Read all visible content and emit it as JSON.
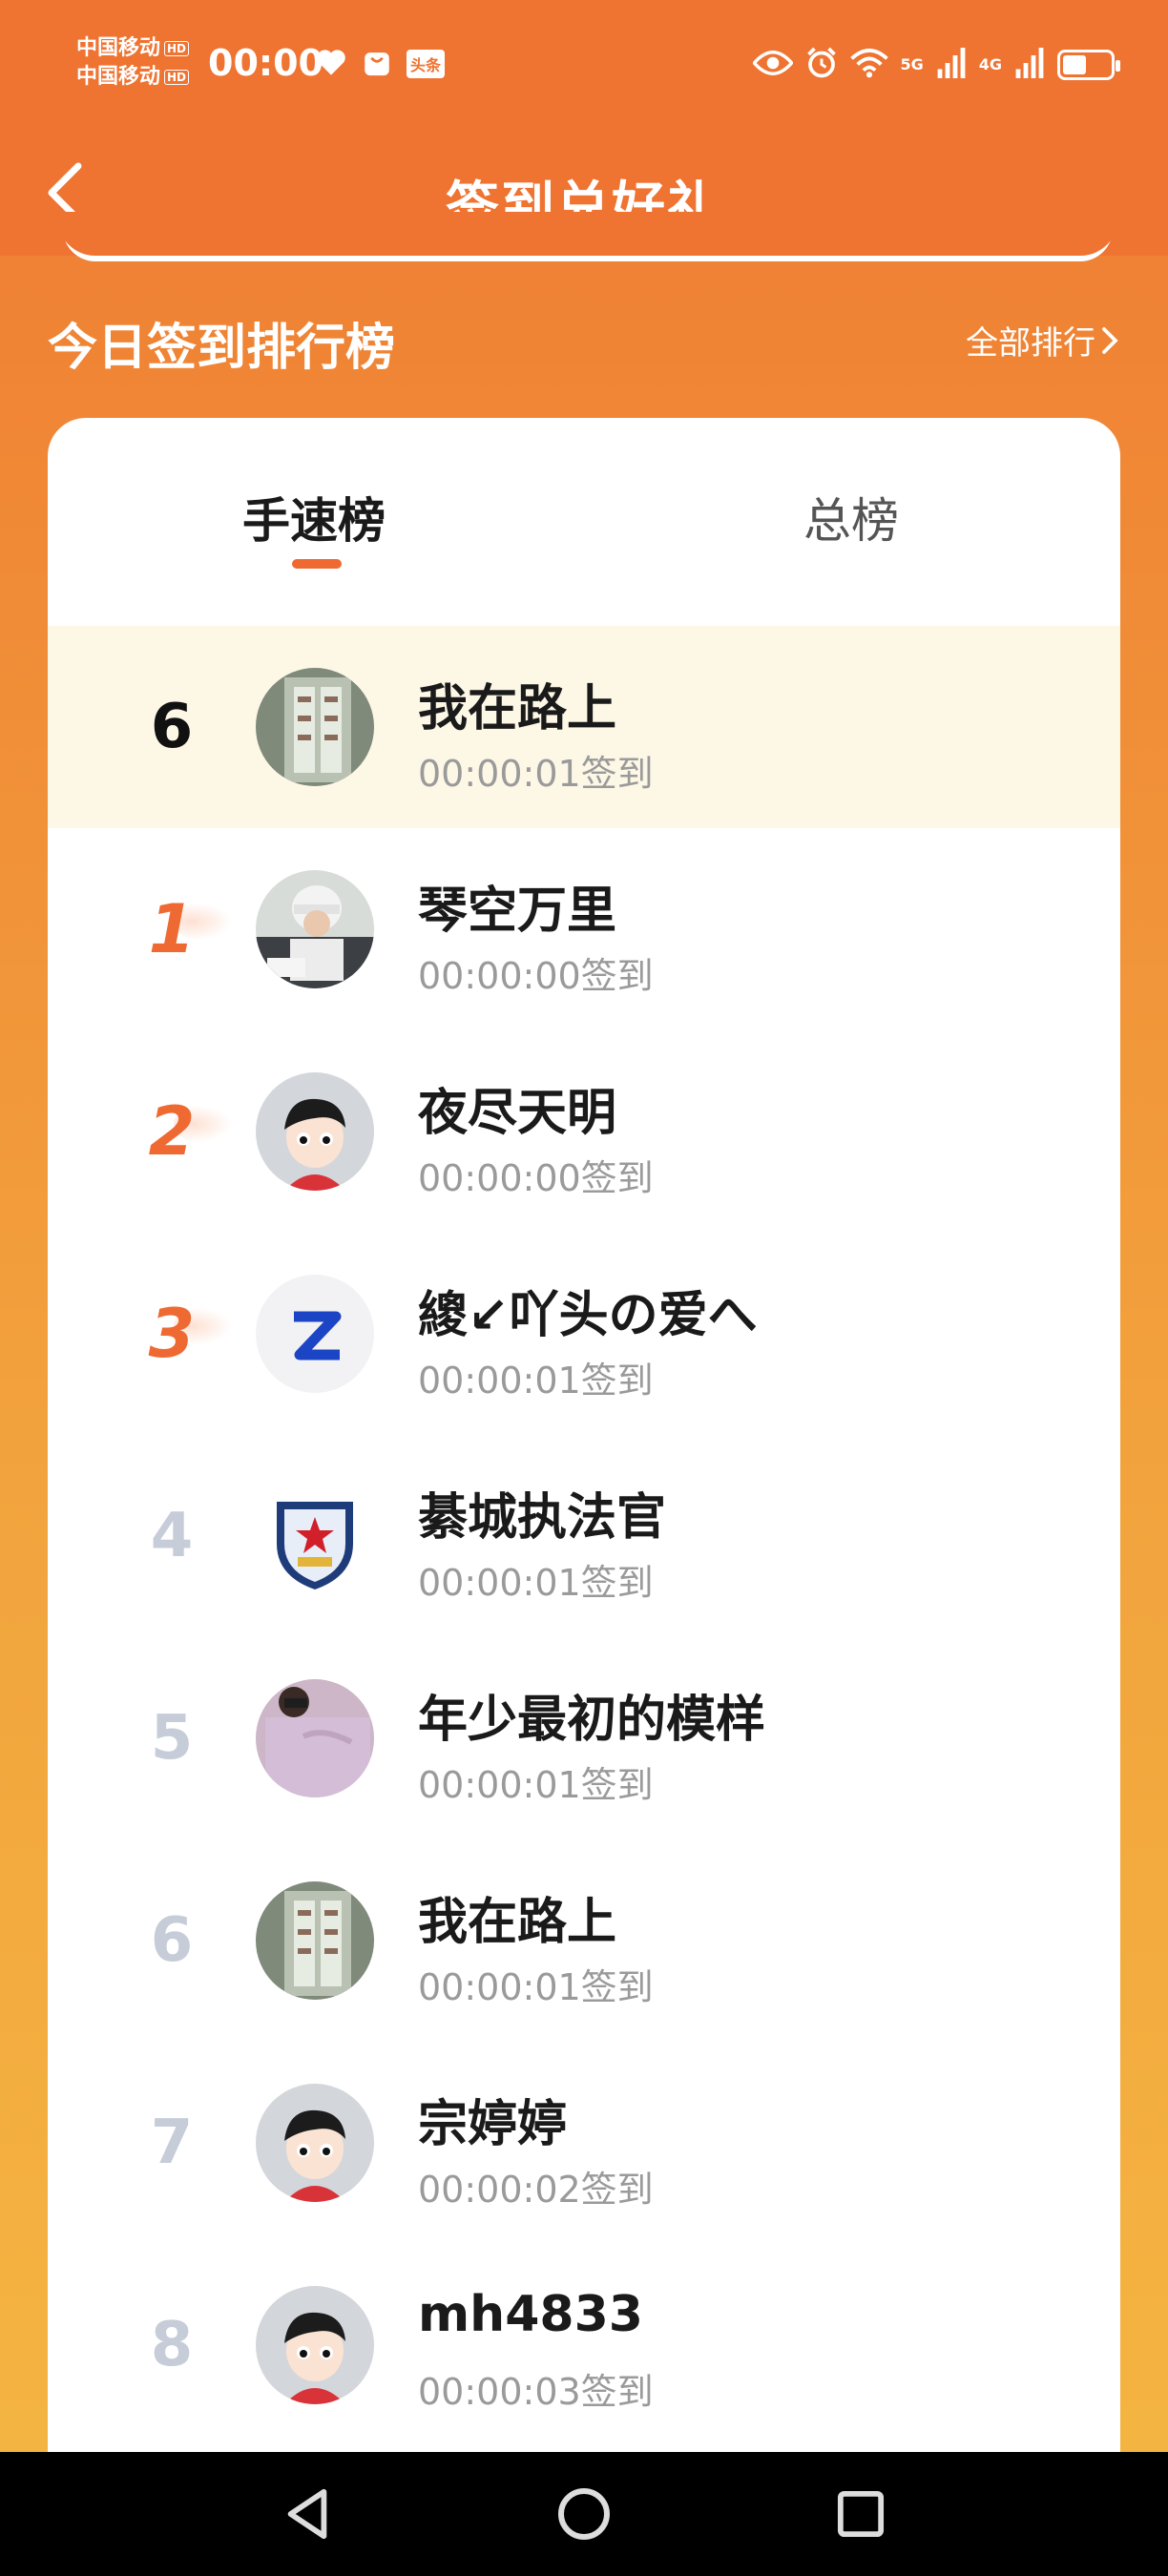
{
  "status_bar": {
    "carrier1": "中国移动",
    "carrier2": "中国移动",
    "hd": "HD",
    "time": "00:00",
    "app_badge": "头条",
    "net_5g": "5G",
    "net_4g": "4G"
  },
  "header": {
    "title": "签到兑好礼"
  },
  "section": {
    "title": "今日签到排行榜",
    "view_all": "全部排行"
  },
  "tabs": [
    {
      "label": "手速榜",
      "active": true
    },
    {
      "label": "总榜",
      "active": false
    }
  ],
  "my_entry": {
    "rank": "6",
    "name": "我在路上",
    "time": "00:00:01签到",
    "avatar": "building-photo-avatar"
  },
  "ranking": [
    {
      "rank": "1",
      "name": "琴空万里",
      "time": "00:00:00签到",
      "avatar": "child-photo-avatar"
    },
    {
      "rank": "2",
      "name": "夜尽天明",
      "time": "00:00:00签到",
      "avatar": "default-cartoon-avatar"
    },
    {
      "rank": "3",
      "name": "繌↙吖头の爱へ",
      "time": "00:00:01签到",
      "avatar": "letter-z-avatar"
    },
    {
      "rank": "4",
      "name": "綦城执法官",
      "time": "00:00:01签到",
      "avatar": "police-badge-avatar"
    },
    {
      "rank": "5",
      "name": "年少最初的模样",
      "time": "00:00:01签到",
      "avatar": "person-photo-avatar"
    },
    {
      "rank": "6",
      "name": "我在路上",
      "time": "00:00:01签到",
      "avatar": "building-photo-avatar"
    },
    {
      "rank": "7",
      "name": "宗婷婷",
      "time": "00:00:02签到",
      "avatar": "default-cartoon-avatar"
    },
    {
      "rank": "8",
      "name": "mh4833",
      "time": "00:00:03签到",
      "avatar": "default-cartoon-avatar"
    }
  ],
  "colors": {
    "accent": "#ee6a32",
    "header_bg": "#ef7331",
    "highlight_row": "#fdf7e6",
    "rank_muted": "#c6ccd8",
    "time_text": "#9a9a9a"
  }
}
